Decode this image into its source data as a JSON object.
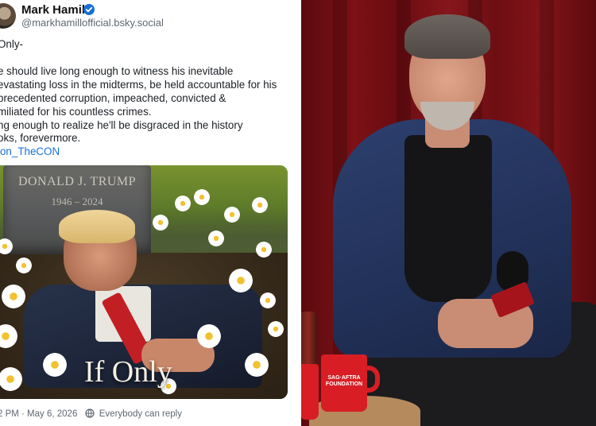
{
  "post": {
    "author": {
      "name": "Mark Hamill",
      "handle": "@markhamillofficial.bsky.social",
      "verified_icon": "verified-check-icon",
      "accent": "#1a6fd8"
    },
    "text_lines": [
      "Only-",
      "",
      "e should live long enough to witness his inevitable",
      "evastating loss in the midterms, be held accountable for his",
      "precedented corruption, impeached, convicted &",
      "miliated for his countless crimes.",
      "ng enough to realize he'll be disgraced in the history",
      "oks, forevermore."
    ],
    "hashtag": "ion_TheCON",
    "image": {
      "gravestone_name": "DONALD J. TRUMP",
      "gravestone_dates": "1946 – 2024",
      "caption": "If Only"
    },
    "footer": {
      "timestamp": "2 PM · May 6, 2026",
      "reply_setting": "Everybody can reply",
      "reply_icon": "everyone-reply-icon"
    }
  },
  "photo": {
    "mug_label": "SAG·AFTRA FOUNDATION"
  }
}
